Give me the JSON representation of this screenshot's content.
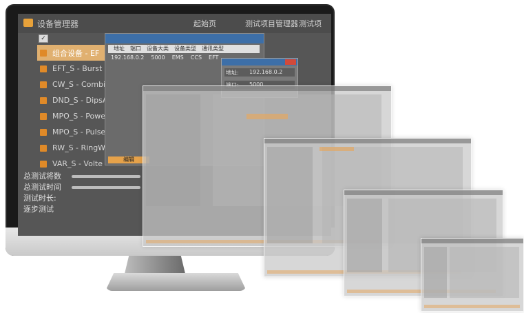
{
  "app": {
    "title": "设备管理器",
    "menu_label": "起始页",
    "tab_label": "测试项目管理器",
    "tab2_label": "测试项"
  },
  "device_list": {
    "items": [
      {
        "label": "组合设备 - EF"
      },
      {
        "label": "EFT_S - Burst"
      },
      {
        "label": "CW_S - Combin"
      },
      {
        "label": "DND_S - DipsA"
      },
      {
        "label": "MPO_S - Power"
      },
      {
        "label": "MPO_S - Pulse-"
      },
      {
        "label": "RW_S - RingWa"
      },
      {
        "label": "VAR_S - Volte"
      }
    ]
  },
  "device_table": {
    "headers": [
      "地址",
      "端口",
      "设备大类",
      "设备类型",
      "通讯类型"
    ],
    "row": [
      "192.168.0.2",
      "5000",
      "EMS",
      "CCS",
      "EFT"
    ],
    "edit_button": "编辑"
  },
  "address_dialog": {
    "addr_label": "地址:",
    "addr_value": "192.168.0.2",
    "port_label": "端口:",
    "port_value": "5000"
  },
  "status": {
    "total_count_label": "总测试将数",
    "total_time_label": "总测试时间",
    "duration_label": "测试时长:",
    "step_label": "逐步测试"
  }
}
